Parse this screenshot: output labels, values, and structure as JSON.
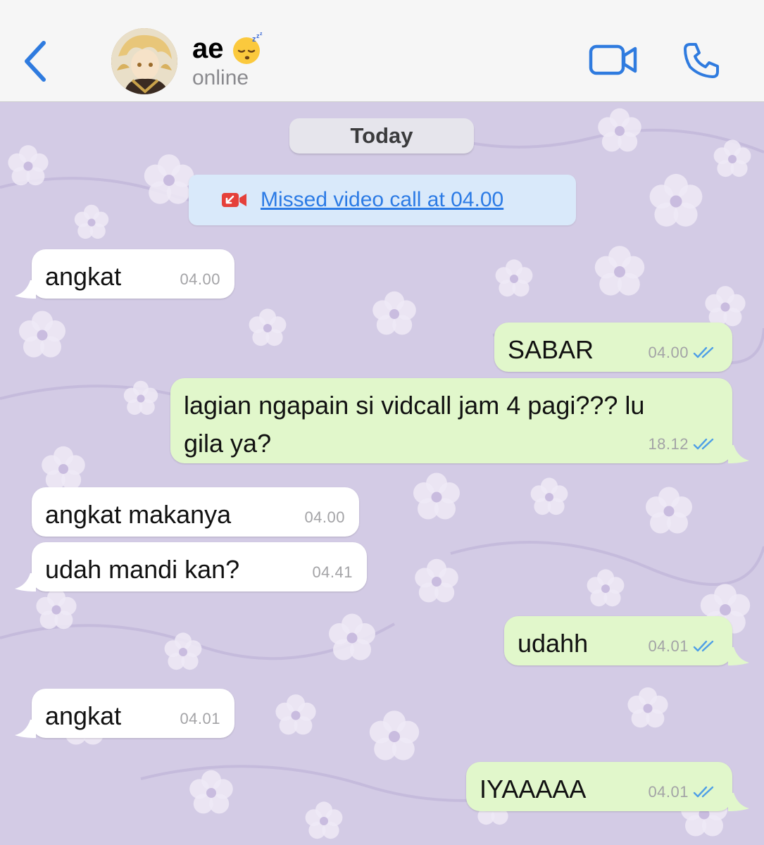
{
  "header": {
    "contact_name": "ae",
    "contact_emoji": "sleeping-face-emoji",
    "status": "online",
    "back_icon": "chevron-left-icon",
    "video_icon": "video-camera-icon",
    "phone_icon": "phone-icon",
    "accent_color": "#2f7bdf"
  },
  "chat": {
    "background_color": "#d3cbe5",
    "date_label": "Today",
    "missed_call": {
      "icon": "missed-video-call-icon",
      "text": "Missed video call at 04.00",
      "icon_color": "#e5403a"
    },
    "messages": [
      {
        "direction": "incoming",
        "text": "angkat",
        "time": "04.00"
      },
      {
        "direction": "outgoing",
        "text": "SABAR",
        "time": "04.00",
        "read": true
      },
      {
        "direction": "outgoing",
        "text_line1": "lagian ngapain si vidcall jam 4 pagi??? lu",
        "text_line2": "gila ya?",
        "time": "18.12",
        "read": true
      },
      {
        "direction": "incoming",
        "text": "angkat makanya",
        "time": "04.00"
      },
      {
        "direction": "incoming",
        "text": "udah mandi kan?",
        "time": "04.41"
      },
      {
        "direction": "outgoing",
        "text": "udahh",
        "time": "04.01",
        "read": true
      },
      {
        "direction": "incoming",
        "text": "angkat",
        "time": "04.01"
      },
      {
        "direction": "outgoing",
        "text": "IYAAAAA",
        "time": "04.01",
        "read": true
      }
    ],
    "incoming_bubble_color": "#ffffff",
    "outgoing_bubble_color": "#e1f7cb",
    "read_check_color": "#4f9fe6"
  }
}
